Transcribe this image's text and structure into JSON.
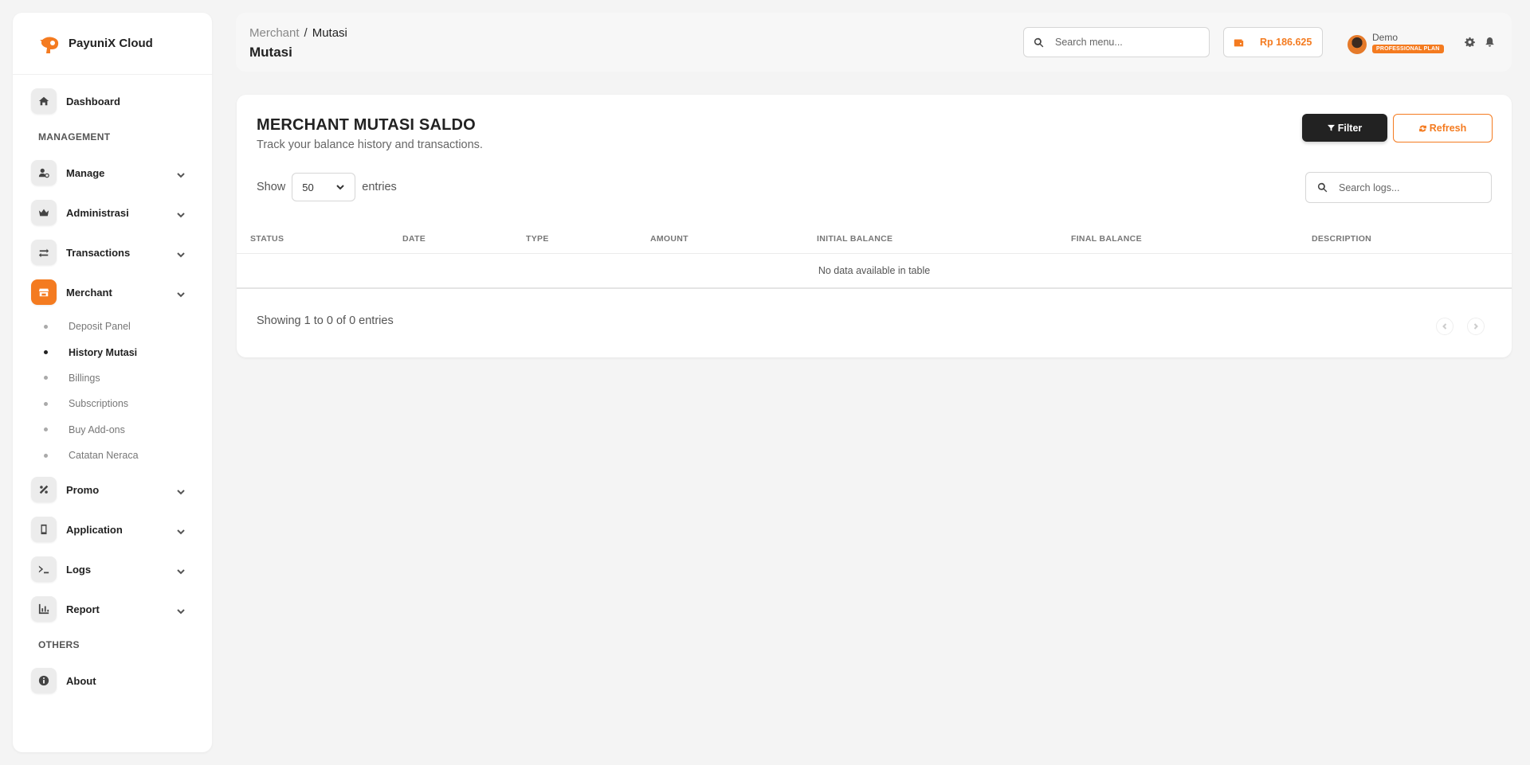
{
  "brand": {
    "name": "PayuniX Cloud",
    "accent": "#f47b20"
  },
  "sidebar": {
    "dashboard": {
      "label": "Dashboard",
      "icon": "home-icon"
    },
    "management_label": "MANAGEMENT",
    "items": [
      {
        "label": "Manage",
        "icon": "user-gear-icon"
      },
      {
        "label": "Administrasi",
        "icon": "crown-icon"
      },
      {
        "label": "Transactions",
        "icon": "exchange-icon"
      },
      {
        "label": "Merchant",
        "icon": "store-icon",
        "active": true
      }
    ],
    "merchant_sub": [
      {
        "label": "Deposit Panel"
      },
      {
        "label": "History Mutasi",
        "active": true
      },
      {
        "label": "Billings"
      },
      {
        "label": "Subscriptions"
      },
      {
        "label": "Buy Add-ons"
      },
      {
        "label": "Catatan Neraca"
      }
    ],
    "items2": [
      {
        "label": "Promo",
        "icon": "percent-icon"
      },
      {
        "label": "Application",
        "icon": "mobile-icon"
      },
      {
        "label": "Logs",
        "icon": "terminal-icon"
      },
      {
        "label": "Report",
        "icon": "chart-icon"
      }
    ],
    "others_label": "OTHERS",
    "about": {
      "label": "About",
      "icon": "info-icon"
    }
  },
  "header": {
    "breadcrumb": {
      "parent": "Merchant",
      "separator": "/",
      "current": "Mutasi"
    },
    "title": "Mutasi",
    "search_placeholder": "Search menu...",
    "balance": "Rp 186.625",
    "user": {
      "name": "Demo",
      "plan": "PROFESSIONAL PLAN"
    }
  },
  "card": {
    "title": "MERCHANT MUTASI SALDO",
    "subtitle": "Track your balance history and transactions.",
    "filter_label": "Filter",
    "refresh_label": "Refresh",
    "show_label": "Show",
    "entries_value": "50",
    "entries_label": "entries",
    "search_placeholder": "Search logs...",
    "columns": [
      "STATUS",
      "DATE",
      "TYPE",
      "AMOUNT",
      "INITIAL BALANCE",
      "FINAL BALANCE",
      "DESCRIPTION"
    ],
    "empty_text": "No data available in table",
    "showing_text": "Showing 1 to 0 of 0 entries"
  }
}
